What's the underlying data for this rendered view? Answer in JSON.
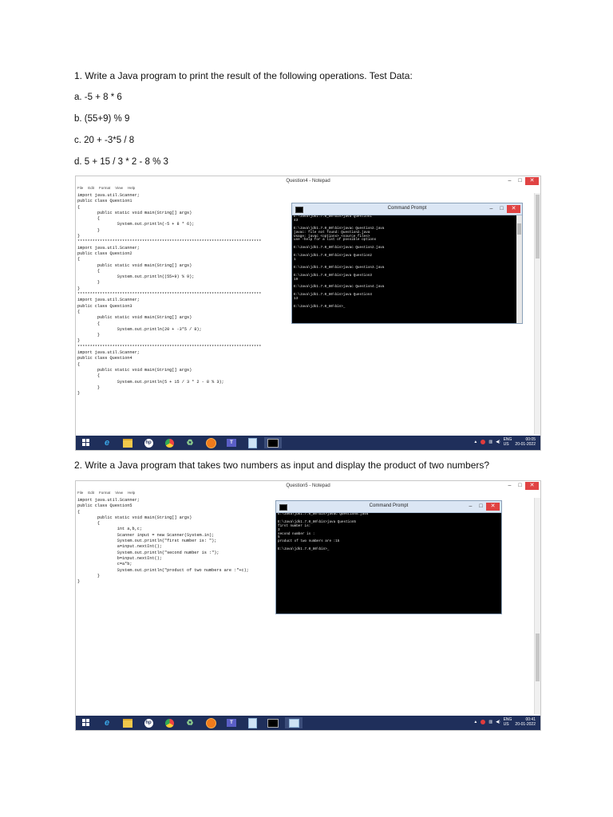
{
  "questions": {
    "q1": "1. Write a Java program to print the result of the following operations. Test Data:",
    "test_items": [
      "a.  -5 + 8 * 6",
      "b.  (55+9) % 9",
      "c.  20 + -3*5 / 8",
      "d.  5 + 15 / 3 * 2 - 8 % 3"
    ],
    "q2": "2. Write a Java program that takes two numbers as input and display the product of two numbers?"
  },
  "screenshot1": {
    "notepad_title": "Question4 - Notepad",
    "menu": [
      "File",
      "Edit",
      "Format",
      "View",
      "Help"
    ],
    "code": "import java.util.Scanner;\npublic class Question1\n{\n        public static void main(String[] args)\n        {\n                System.out.println(-5 + 8 * 6);\n        }\n}\n**************************************************************************\nimport java.util.Scanner;\npublic class Question2\n{\n        public static void main(String[] args)\n        {\n                System.out.println((55+9) % 9);\n        }\n}\n**************************************************************************\nimport java.util.Scanner;\npublic class Question3\n{\n        public static void main(String[] args)\n        {\n                System.out.println(20 + -3*5 / 8);\n        }\n}\n**************************************************************************\nimport java.util.Scanner;\npublic class Question4\n{\n        public static void main(String[] args)\n        {\n                System.out.println(5 + 15 / 3 * 2 - 8 % 3);\n        }\n}",
    "cmd_title": "Command Prompt",
    "cmd_text": "E:\\Java\\jdk1.7.0_80\\bin>java Question1\n43\n\nE:\\Java\\jdk1.7.0_80\\bin>javac Question2.java\njavac: file not found: Question2.java\nUsage: javac <options> <source files>\nuse -help for a list of possible options\n\nE:\\Java\\jdk1.7.0_80\\bin>javac Question2.java\n\nE:\\Java\\jdk1.7.0_80\\bin>java Question2\n1\n\nE:\\Java\\jdk1.7.0_80\\bin>javac Question3.java\n\nE:\\Java\\jdk1.7.0_80\\bin>java Question3\n19\n\nE:\\Java\\jdk1.7.0_80\\bin>javac Question4.java\n\nE:\\Java\\jdk1.7.0_80\\bin>java Question4\n13\n\nE:\\Java\\jdk1.7.0_80\\bin>_",
    "tray": {
      "lang": "ENG",
      "region": "US",
      "time": "00:05",
      "date": "20-01-2022"
    }
  },
  "screenshot2": {
    "notepad_title": "Question5 - Notepad",
    "menu": [
      "File",
      "Edit",
      "Format",
      "View",
      "Help"
    ],
    "code": "import java.util.Scanner;\npublic class Question5\n{\n        public static void main(String[] args)\n        {\n                int a,b,c;\n                Scanner input = new Scanner(System.in);\n                System.out.println(\"first number is: \");\n                a=input.nextInt();\n                System.out.println(\"second number is :\");\n                b=input.nextInt();\n                c=a*b;\n                System.out.println(\"product of two numbers are :\"+c);\n        }\n}",
    "cmd_title": "Command Prompt",
    "cmd_text": "E:\\Java\\jdk1.7.0_80\\bin>javac Question5.java\n\nE:\\Java\\jdk1.7.0_80\\bin>java Question5\nfirst number is:\n3\nsecond number is :\n5\nproduct of two numbers are :15\n\nE:\\Java\\jdk1.7.0_80\\bin>_",
    "tray": {
      "lang": "ENG",
      "region": "US",
      "time": "00:41",
      "date": "20-01-2022"
    }
  },
  "taskbar_icons": [
    "windows-start-icon",
    "internet-explorer-icon",
    "file-explorer-icon",
    "hp-icon",
    "chrome-icon",
    "recycle-icon",
    "firefox-icon",
    "teams-icon",
    "notepad-icon",
    "cmd-icon"
  ],
  "colors": {
    "taskbar": "#1f2f5b",
    "close": "#e04343",
    "cmd_bg": "#000000",
    "cmd_titlebar": "#dbe6f4"
  }
}
